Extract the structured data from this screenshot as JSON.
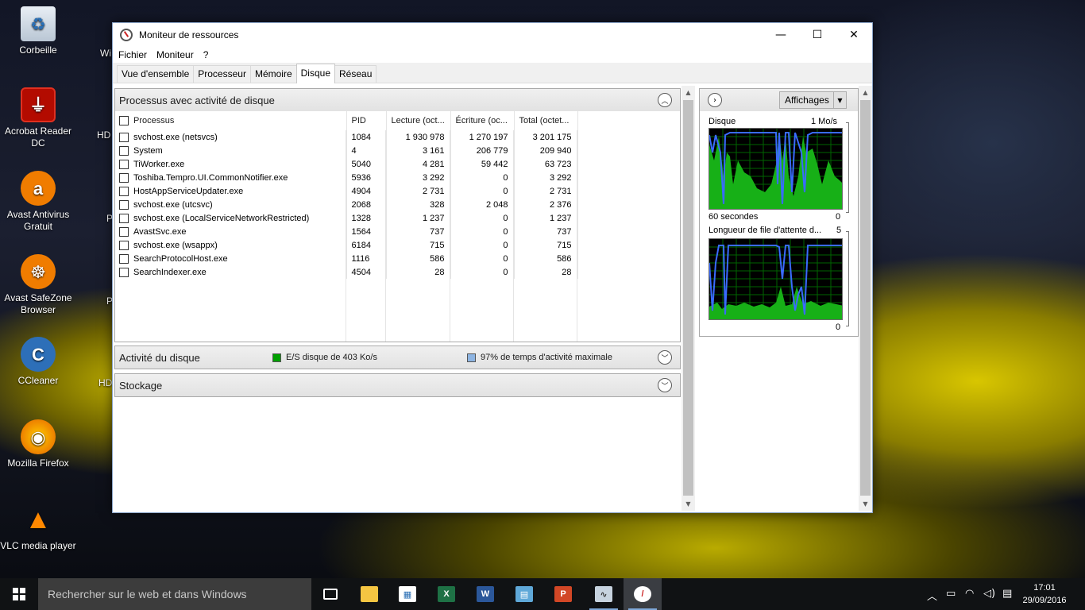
{
  "desktop": {
    "icons": [
      {
        "label": "Corbeille",
        "icon": "recycle-bin-icon"
      },
      {
        "label": "Acrobat Reader DC",
        "icon": "acrobat-icon"
      },
      {
        "label": "Avast Antivirus Gratuit",
        "icon": "avast-icon"
      },
      {
        "label": "Avast SafeZone Browser",
        "icon": "safezone-icon"
      },
      {
        "label": "CCleaner",
        "icon": "ccleaner-icon"
      },
      {
        "label": "Mozilla Firefox",
        "icon": "firefox-icon"
      },
      {
        "label": "VLC media player",
        "icon": "vlc-icon"
      }
    ],
    "partial_labels": [
      "Wi",
      "HD",
      "P",
      "P",
      "HD"
    ]
  },
  "window": {
    "title": "Moniteur de ressources",
    "controls": {
      "minimize": "—",
      "maximize": "☐",
      "close": "✕"
    },
    "menu": [
      "Fichier",
      "Moniteur",
      "?"
    ],
    "tabs": [
      "Vue d'ensemble",
      "Processeur",
      "Mémoire",
      "Disque",
      "Réseau"
    ],
    "active_tab": "Disque"
  },
  "processes_section": {
    "title": "Processus avec activité de disque",
    "columns": [
      "Processus",
      "PID",
      "Lecture (oct...",
      "Écriture (oc...",
      "Total (octet..."
    ],
    "rows": [
      [
        "svchost.exe (netsvcs)",
        "1084",
        "1 930 978",
        "1 270 197",
        "3 201 175"
      ],
      [
        "System",
        "4",
        "3 161",
        "206 779",
        "209 940"
      ],
      [
        "TiWorker.exe",
        "5040",
        "4 281",
        "59 442",
        "63 723"
      ],
      [
        "Toshiba.Tempro.UI.CommonNotifier.exe",
        "5936",
        "3 292",
        "0",
        "3 292"
      ],
      [
        "HostAppServiceUpdater.exe",
        "4904",
        "2 731",
        "0",
        "2 731"
      ],
      [
        "svchost.exe (utcsvc)",
        "2068",
        "328",
        "2 048",
        "2 376"
      ],
      [
        "svchost.exe (LocalServiceNetworkRestricted)",
        "1328",
        "1 237",
        "0",
        "1 237"
      ],
      [
        "AvastSvc.exe",
        "1564",
        "737",
        "0",
        "737"
      ],
      [
        "svchost.exe (wsappx)",
        "6184",
        "715",
        "0",
        "715"
      ],
      [
        "SearchProtocolHost.exe",
        "1116",
        "586",
        "0",
        "586"
      ],
      [
        "SearchIndexer.exe",
        "4504",
        "28",
        "0",
        "28"
      ]
    ]
  },
  "disk_activity_section": {
    "title": "Activité du disque",
    "io_text": "E/S disque de 403 Ko/s",
    "active_time_text": "97% de temps d'activité maximale",
    "io_color": "#00a000",
    "active_color": "#8db4e2"
  },
  "storage_section": {
    "title": "Stockage"
  },
  "right_pane": {
    "view_button": "Affichages",
    "graph1": {
      "title": "Disque",
      "max": "1 Mo/s",
      "time": "60 secondes",
      "min": "0"
    },
    "graph2": {
      "title": "Longueur de file d'attente d...",
      "max": "5",
      "min": "0"
    }
  },
  "taskbar": {
    "search_placeholder": "Rechercher sur le web et dans Windows",
    "apps": [
      "task-view-icon",
      "file-explorer-icon",
      "store-icon",
      "excel-icon",
      "word-icon",
      "control-panel-icon",
      "powerpoint-icon",
      "perfmon-icon",
      "resource-monitor-icon"
    ],
    "time": "17:01",
    "date": "29/09/2016"
  }
}
